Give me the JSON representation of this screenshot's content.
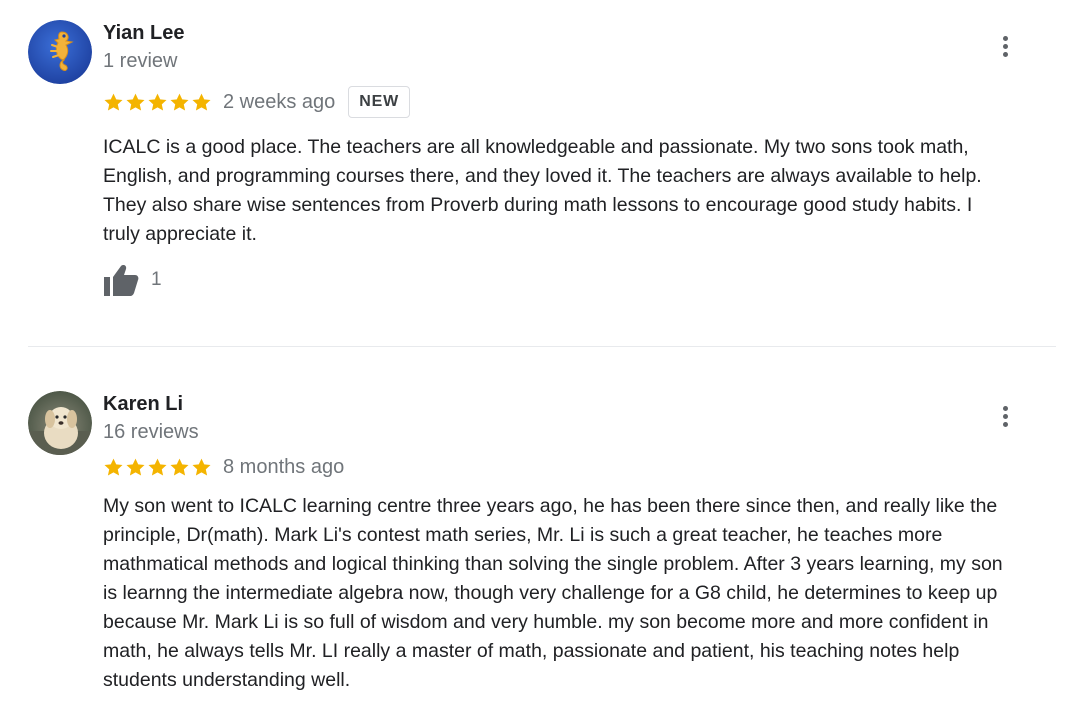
{
  "colors": {
    "star": "#f4b400",
    "text": "#202124",
    "secondary": "#70757a",
    "divider": "#e8eaed"
  },
  "reviews": [
    {
      "author": "Yian Lee",
      "review_count": "1 review",
      "rating": 5,
      "date": "2 weeks ago",
      "badge": "NEW",
      "text": "ICALC is a good place. The teachers are all knowledgeable and passionate. My two sons took math,\nEnglish, and programming courses there, and they loved it. The teachers are always available to help.\nThey also share wise sentences from Proverb during math lessons to encourage good study habits. I\ntruly appreciate it.",
      "likes": "1",
      "avatar_icon": "seahorse-icon",
      "more_icon": "more-vert-icon",
      "like_icon": "thumbs-up-icon"
    },
    {
      "author": "Karen Li",
      "review_count": "16 reviews",
      "rating": 5,
      "date": "8 months ago",
      "text": "My son went to ICALC learning centre three years ago,  he has been there since then, and really like the\nprinciple, Dr(math). Mark Li's contest math series, Mr. Li is such a great teacher, he teaches more\nmathmatical methods and logical thinking than solving the single problem. After 3 years learning, my son\nis learnng the intermediate algebra now, though very challenge for a G8 child, he determines to keep up\nbecause Mr.  Mark Li is so full of wisdom and very humble. my son become more and more confident in\nmath, he always tells Mr. LI really a master of math, passionate and patient,  his teaching notes help\nstudents understanding well.",
      "avatar_icon": "dog-photo-avatar",
      "more_icon": "more-vert-icon"
    }
  ]
}
